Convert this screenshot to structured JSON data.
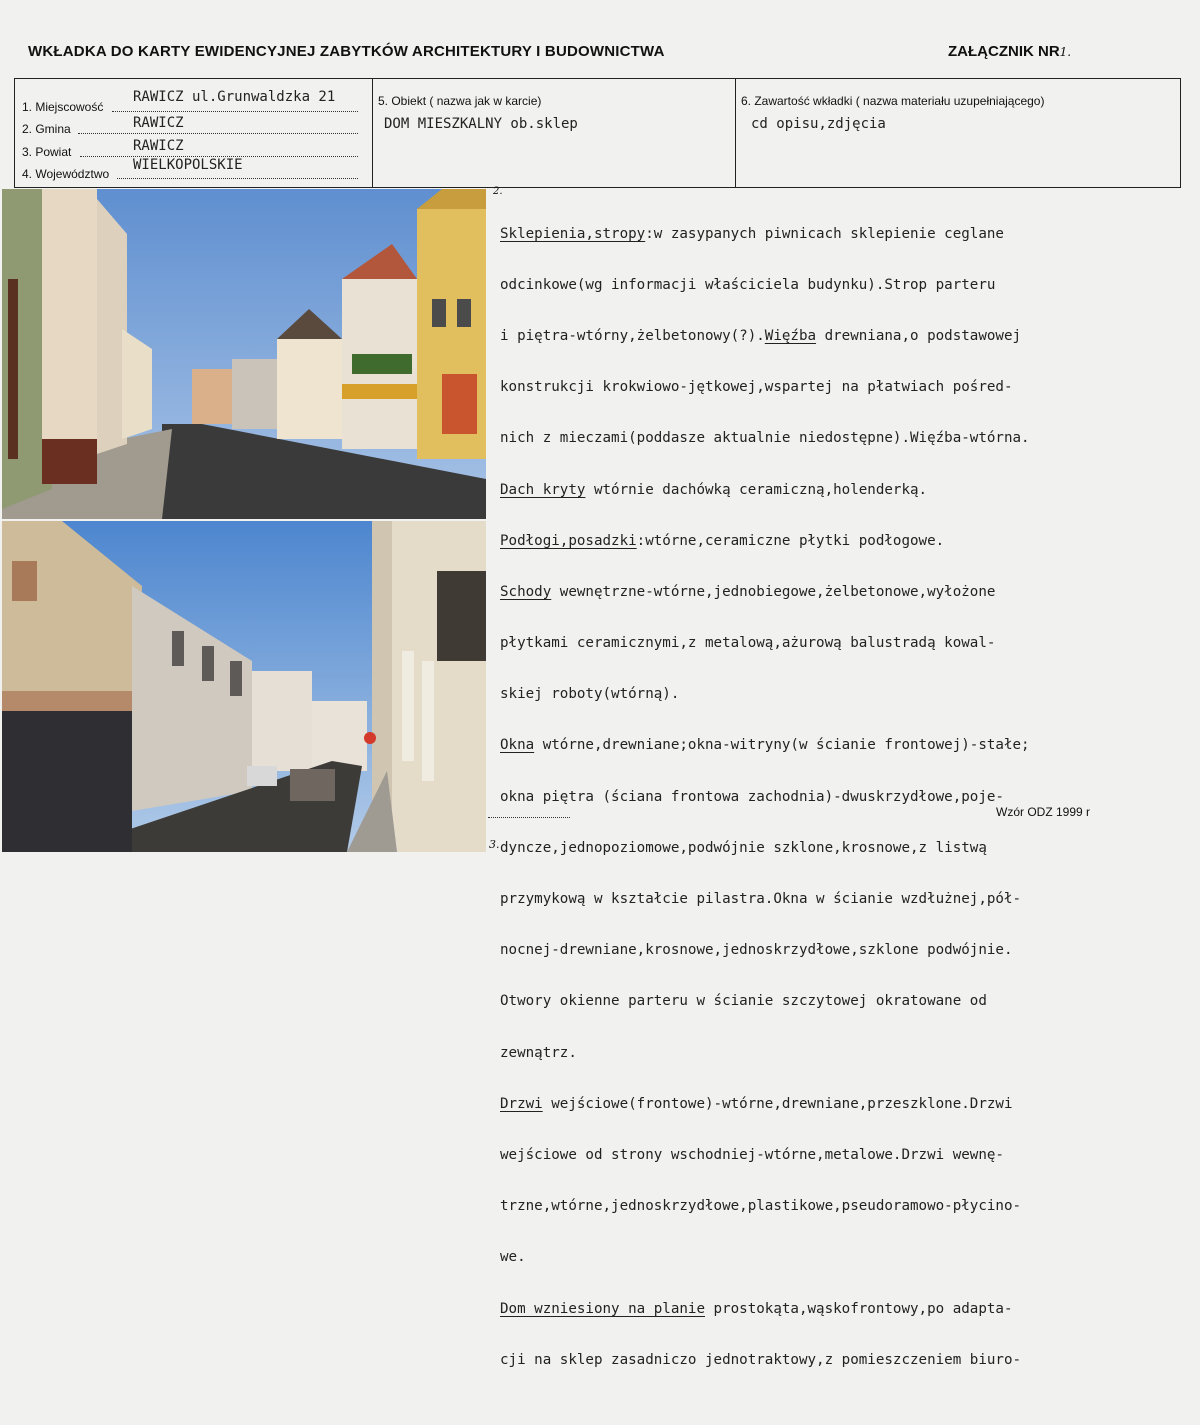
{
  "header": {
    "title": "WKŁADKA DO KARTY EWIDENCYJNEJ ZABYTKÓW ARCHITEKTURY I BUDOWNICTWA",
    "annex_label": "ZAŁĄCZNIK NR",
    "annex_number": "1."
  },
  "fields": {
    "f1_label": "1. Miejscowość",
    "f1_value": "RAWICZ  ul.Grunwaldzka 21",
    "f2_label": "2. Gmina",
    "f2_value": "RAWICZ",
    "f3_label": "3. Powiat",
    "f3_value": "RAWICZ",
    "f4_label": "4. Województwo",
    "f4_value": "WIELKOPOLSKIE",
    "f5_label": "5. Obiekt ( nazwa jak w karcie)",
    "f5_value": "DOM MIESZKALNY ob.sklep",
    "f6_label": "6. Zawartość wkładki  ( nazwa materiału uzupełniającego)",
    "f6_value": "cd opisu,zdjęcia"
  },
  "page_numbers": {
    "top": "2.",
    "bottom": "3."
  },
  "description": {
    "l1_a": "Sklepienia,stropy",
    "l1_b": ":w zasypanych piwnicach sklepienie ceglane",
    "l2": "odcinkowe(wg informacji właściciela budynku).Strop parteru",
    "l3_a": "i piętra-wtórny,żelbetonowy(?).",
    "l3_b": "Więźba",
    "l3_c": " drewniana,o podstawowej",
    "l4": "konstrukcji krokwiowo-jętkowej,wspartej na płatwiach pośred-",
    "l5": "nich z mieczami(poddasze aktualnie niedostępne).Więźba-wtórna.",
    "l6_a": "Dach kryty",
    "l6_b": " wtórnie dachówką ceramiczną,holenderką.",
    "l7_a": "Podłogi,posadzki",
    "l7_b": ":wtórne,ceramiczne płytki podłogowe.",
    "l8_a": "Schody",
    "l8_b": " wewnętrzne-wtórne,jednobiegowe,żelbetonowe,wyłożone",
    "l9": "płytkami ceramicznymi,z metalową,ażurową balustradą kowal-",
    "l10": "skiej roboty(wtórną).",
    "l11_a": "Okna",
    "l11_b": " wtórne,drewniane;okna-witryny(w ścianie frontowej)-stałe;",
    "l12": "okna piętra (ściana frontowa zachodnia)-dwuskrzydłowe,poje-",
    "l13": "dyncze,jednopoziomowe,podwójnie szklone,krosnowe,z listwą",
    "l14": "przymykową w kształcie pilastra.Okna w ścianie wzdłużnej,pół-",
    "l15": "nocnej-drewniane,krosnowe,jednoskrzydłowe,szklone podwójnie.",
    "l16": "Otwory okienne parteru w ścianie szczytowej okratowane od",
    "l17": "zewnątrz.",
    "l18_a": "Drzwi",
    "l18_b": " wejściowe(frontowe)-wtórne,drewniane,przeszklone.Drzwi",
    "l19": "wejściowe od strony wschodniej-wtórne,metalowe.Drzwi wewnę-",
    "l20": "trzne,wtórne,jednoskrzydłowe,plastikowe,pseudoramowo-płycino-",
    "l21": "we.",
    "l22_a": "Dom wzniesiony na planie",
    "l22_b": " prostokąta,wąskofrontowy,po adapta-",
    "l23": "cji na sklep zasadniczo jednotraktowy,z pomieszczeniem biuro-"
  },
  "footer": {
    "form_label": "Wzór ODZ  1999 r"
  },
  "colors": {
    "paper": "#f1f1ef",
    "ink": "#222222",
    "sky": "#7ea6d6"
  }
}
